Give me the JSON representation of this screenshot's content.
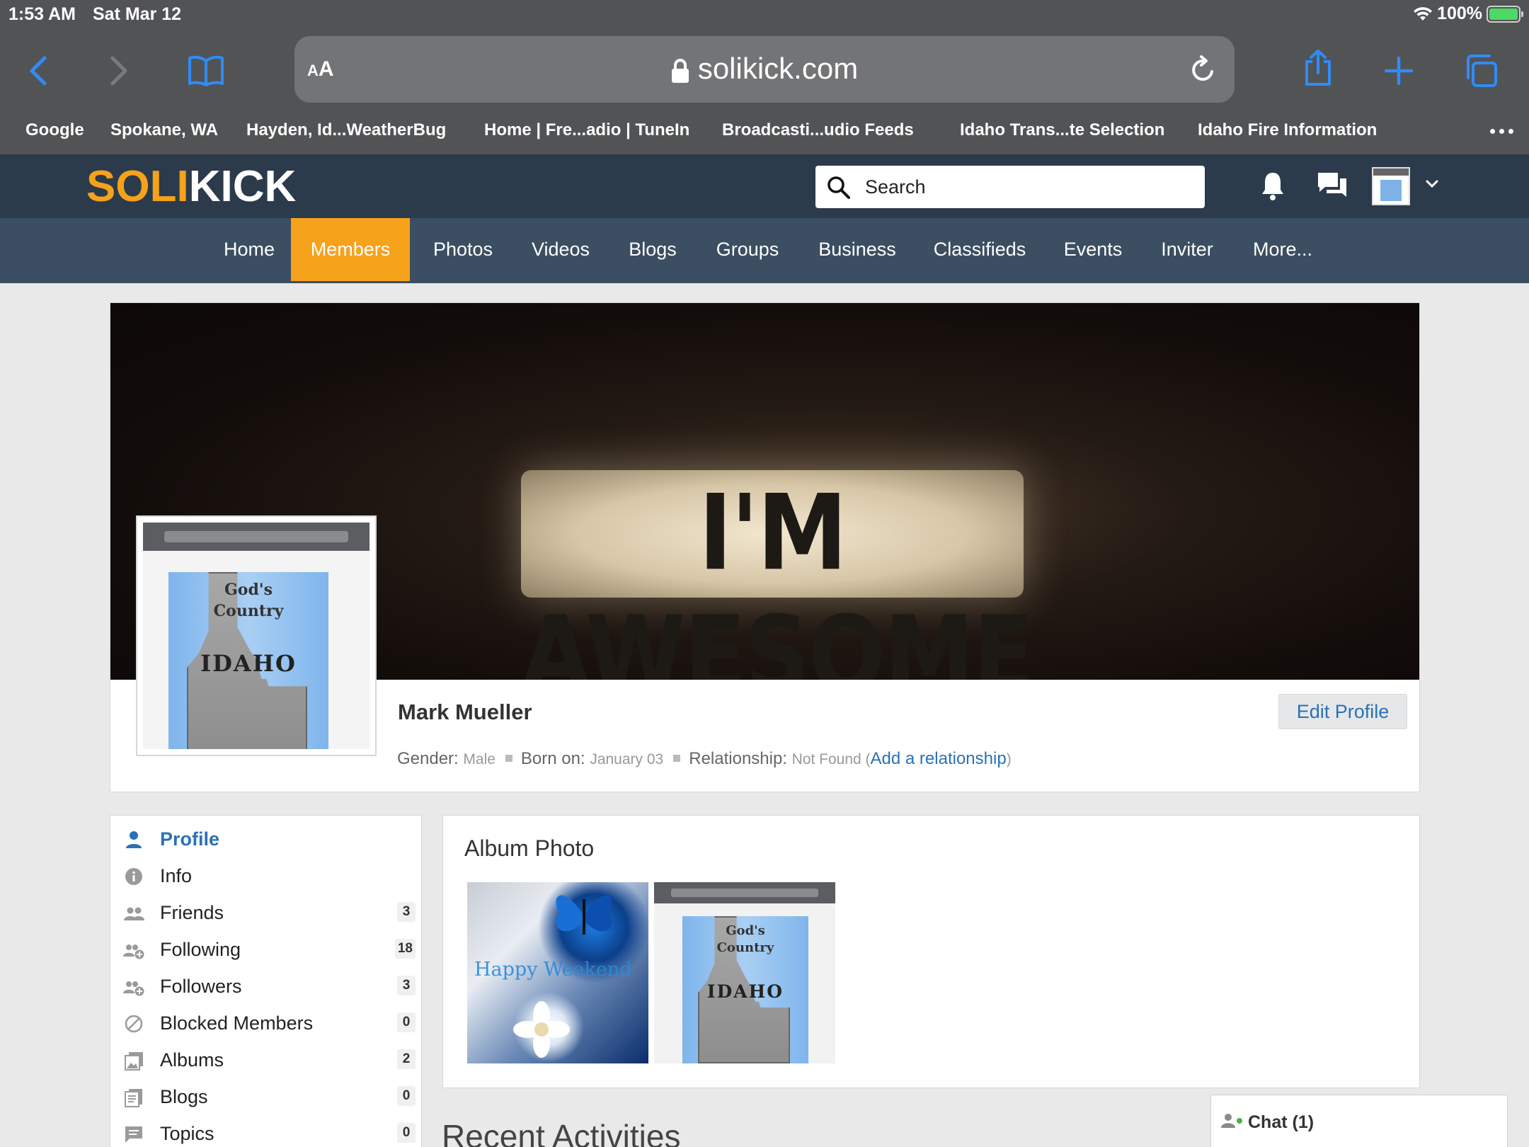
{
  "status": {
    "time": "1:53 AM",
    "date": "Sat Mar 12",
    "battery": "100%"
  },
  "browser": {
    "text_size_label": "AA",
    "url": "solikick.com",
    "bookmarks": [
      "Google",
      "Spokane, WA",
      "Hayden, Id...WeatherBug",
      "Home | Fre...adio | TuneIn",
      "Broadcasti...udio Feeds",
      "Idaho Trans...te Selection",
      "Idaho Fire Information"
    ]
  },
  "site": {
    "logo_part1": "SOLI",
    "logo_part2": "KICK",
    "search_placeholder": "Search",
    "menu": [
      "Home",
      "Members",
      "Photos",
      "Videos",
      "Blogs",
      "Groups",
      "Business",
      "Classifieds",
      "Events",
      "Inviter",
      "More..."
    ],
    "active_menu": "Members"
  },
  "profile": {
    "cover_text": "I'M AWESOME",
    "name": "Mark Mueller",
    "edit_label": "Edit Profile",
    "gender_label": "Gender:",
    "gender": "Male",
    "born_label": "Born on:",
    "born": "January 03",
    "relationship_label": "Relationship:",
    "relationship": "Not Found",
    "add_relationship": "Add a relationship",
    "avatar_text": {
      "line1": "God's",
      "line2": "Country",
      "line3": "IDAHO"
    }
  },
  "sidenav": [
    {
      "label": "Profile",
      "count": null,
      "icon": "person-icon",
      "active": true
    },
    {
      "label": "Info",
      "count": null,
      "icon": "info-icon"
    },
    {
      "label": "Friends",
      "count": "3",
      "icon": "friends-icon"
    },
    {
      "label": "Following",
      "count": "18",
      "icon": "following-icon"
    },
    {
      "label": "Followers",
      "count": "3",
      "icon": "followers-icon"
    },
    {
      "label": "Blocked Members",
      "count": "0",
      "icon": "blocked-icon"
    },
    {
      "label": "Albums",
      "count": "2",
      "icon": "albums-icon"
    },
    {
      "label": "Blogs",
      "count": "0",
      "icon": "blogs-icon"
    },
    {
      "label": "Topics",
      "count": "0",
      "icon": "topics-icon"
    }
  ],
  "album": {
    "title": "Album Photo",
    "photo1_text": "Happy Weekend",
    "photo2_text": {
      "line1": "God's",
      "line2": "Country",
      "line3": "IDAHO"
    }
  },
  "recent_title": "Recent Activities",
  "chat_label": "Chat (1)",
  "colors": {
    "brand_orange": "#f7a21b",
    "header_dark": "#2b3b4c",
    "menu_bar": "#3b4e62",
    "link_blue": "#2a72b5",
    "ios_blue": "#2f8cf6"
  }
}
